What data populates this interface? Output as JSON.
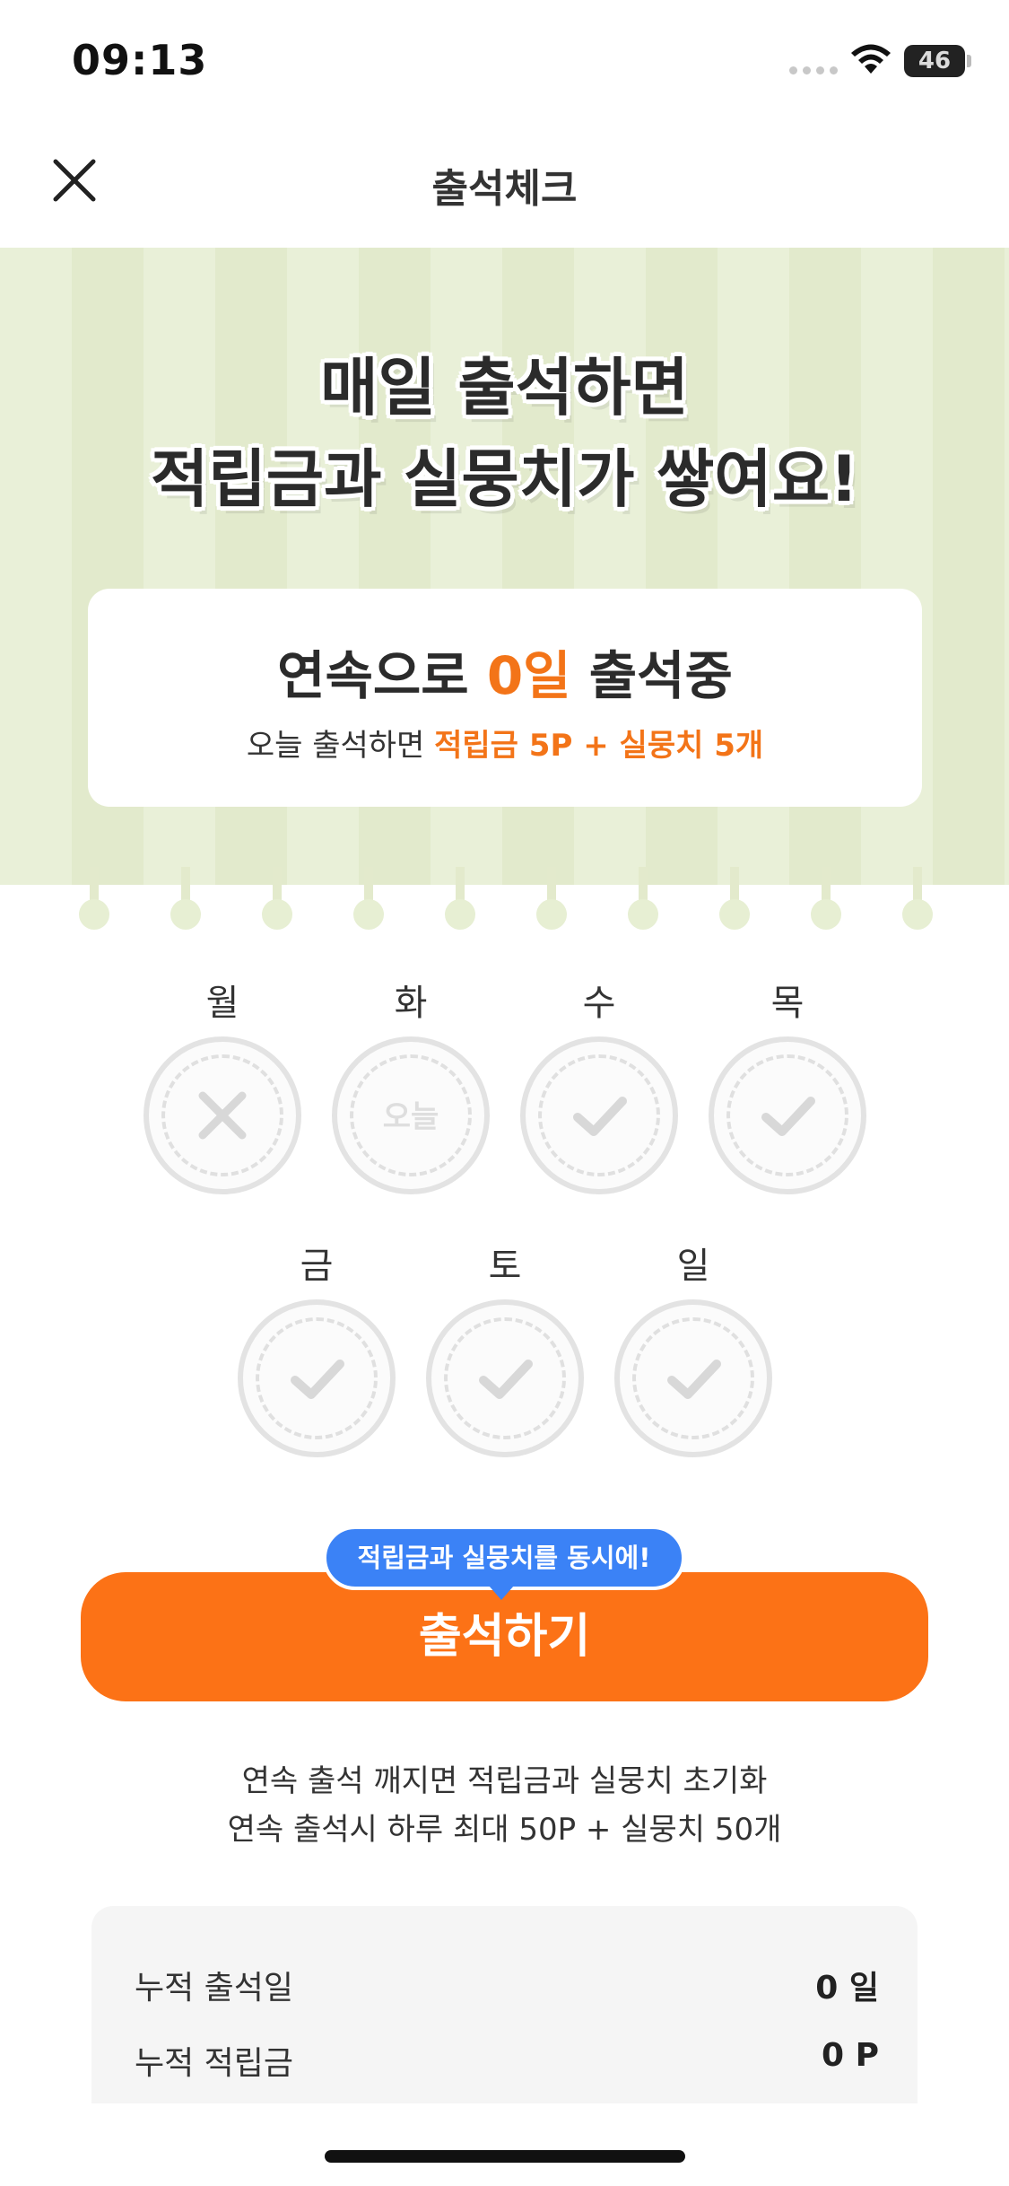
{
  "status_bar": {
    "time": "09:13",
    "battery": "46"
  },
  "header": {
    "title": "출석체크",
    "close_icon": "close-icon"
  },
  "hero": {
    "title_line1": "매일 출석하면",
    "title_line2": "적립금과 실뭉치가 쌓여요!",
    "streak_prefix": "연속으로 ",
    "streak_count": "0일",
    "streak_suffix": " 출석중",
    "reward_prefix": "오늘 출석하면 ",
    "reward_highlight": "적립금 5P + 실뭉치 5개"
  },
  "week": [
    {
      "label": "월",
      "state": "missed",
      "icon": "x-icon"
    },
    {
      "label": "화",
      "state": "today",
      "text": "오늘"
    },
    {
      "label": "수",
      "state": "pending",
      "icon": "check-icon"
    },
    {
      "label": "목",
      "state": "pending",
      "icon": "check-icon"
    },
    {
      "label": "금",
      "state": "pending",
      "icon": "check-icon"
    },
    {
      "label": "토",
      "state": "pending",
      "icon": "check-icon"
    },
    {
      "label": "일",
      "state": "pending",
      "icon": "check-icon"
    }
  ],
  "cta": {
    "tooltip": "적립금과 실뭉치를 동시에!",
    "button_label": "출석하기"
  },
  "notes": {
    "line1": "연속 출석 깨지면 적립금과 실뭉치 초기화",
    "line2": "연속 출석시 하루 최대 50P + 실뭉치 50개"
  },
  "summary": {
    "rows": [
      {
        "label": "누적 출석일",
        "value": "0 일"
      },
      {
        "label": "누적 적립금",
        "value": "0  P"
      }
    ]
  },
  "colors": {
    "accent": "#fc7216",
    "highlight_text": "#f37418",
    "tooltip_bg": "#3b82f6",
    "hero_bg": "#e9f0d8"
  }
}
